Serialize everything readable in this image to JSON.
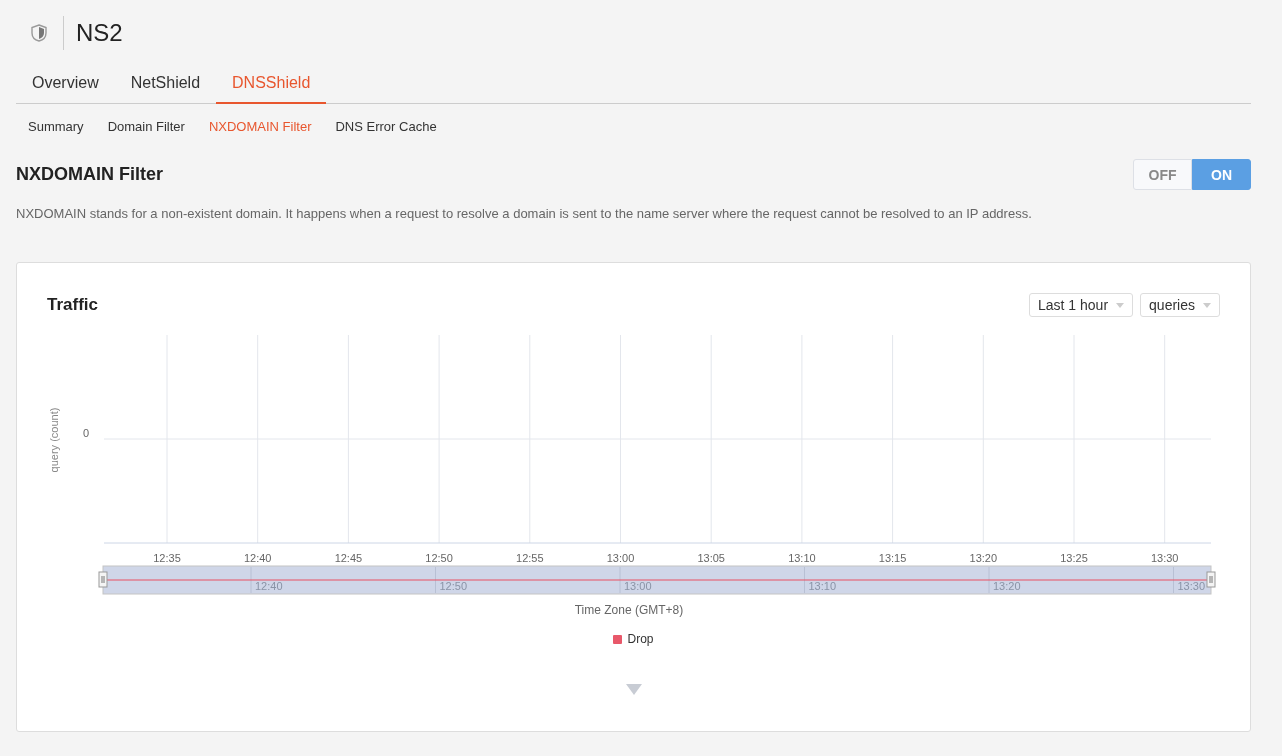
{
  "header": {
    "title": "NS2"
  },
  "tabs": [
    {
      "label": "Overview",
      "selected": false
    },
    {
      "label": "NetShield",
      "selected": false
    },
    {
      "label": "DNSShield",
      "selected": true
    }
  ],
  "subtabs": [
    {
      "label": "Summary",
      "selected": false
    },
    {
      "label": "Domain Filter",
      "selected": false
    },
    {
      "label": "NXDOMAIN Filter",
      "selected": true
    },
    {
      "label": "DNS Error Cache",
      "selected": false
    }
  ],
  "section": {
    "title": "NXDOMAIN Filter",
    "toggle": [
      {
        "label": "OFF",
        "selected": false
      },
      {
        "label": "ON",
        "selected": true
      }
    ],
    "description": "NXDOMAIN stands for a non-existent domain. It happens when a request to resolve a domain is sent to the name server where the request cannot be resolved to an IP address."
  },
  "traffic": {
    "title": "Traffic",
    "range_select": "Last 1 hour",
    "metric_select": "queries",
    "chart": {
      "y_axis_label": "query (count)",
      "y_tick": "0",
      "x_labels": [
        "12:35",
        "12:40",
        "12:45",
        "12:50",
        "12:55",
        "13:00",
        "13:05",
        "13:10",
        "13:15",
        "13:20",
        "13:25",
        "13:30"
      ],
      "x_axis_label": "Time Zone (GMT+8)"
    },
    "navigator": {
      "labels": [
        "12:40",
        "12:50",
        "13:00",
        "13:10",
        "13:20",
        "13:30"
      ]
    },
    "legend": [
      {
        "name": "Drop",
        "color": "#e8586a"
      }
    ]
  }
}
